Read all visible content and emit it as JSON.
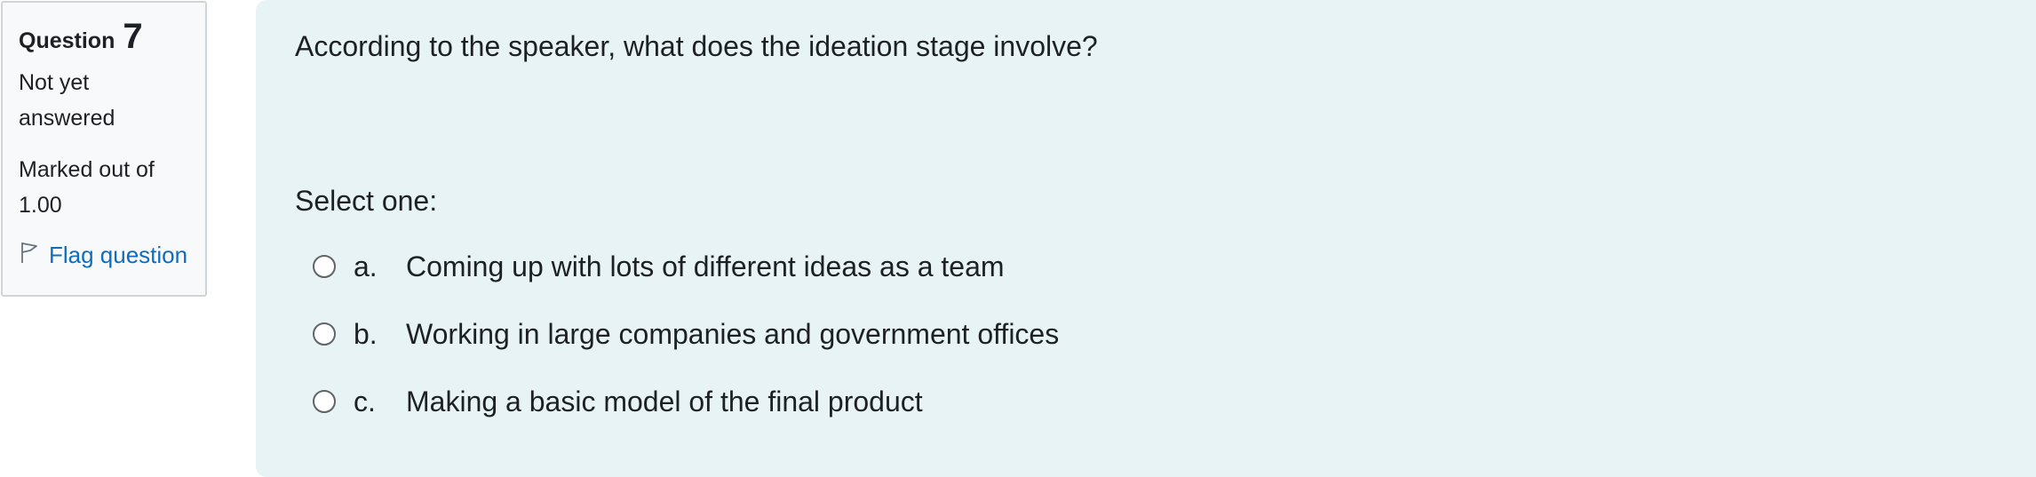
{
  "info": {
    "question_label": "Question",
    "question_number": "7",
    "state": "Not yet answered",
    "grade": "Marked out of 1.00",
    "flag_label": "Flag question"
  },
  "question": {
    "text": "According to the speaker, what does the ideation stage involve?",
    "prompt": "Select one:",
    "answers": [
      {
        "letter": "a.",
        "text": "Coming up with lots of different ideas as a team"
      },
      {
        "letter": "b.",
        "text": "Working in large companies and government offices"
      },
      {
        "letter": "c.",
        "text": "Making a basic model of the final product"
      }
    ]
  },
  "colors": {
    "question_bg": "#e7f3f5",
    "info_bg": "#f8f9fa",
    "link": "#0f6cbf"
  }
}
